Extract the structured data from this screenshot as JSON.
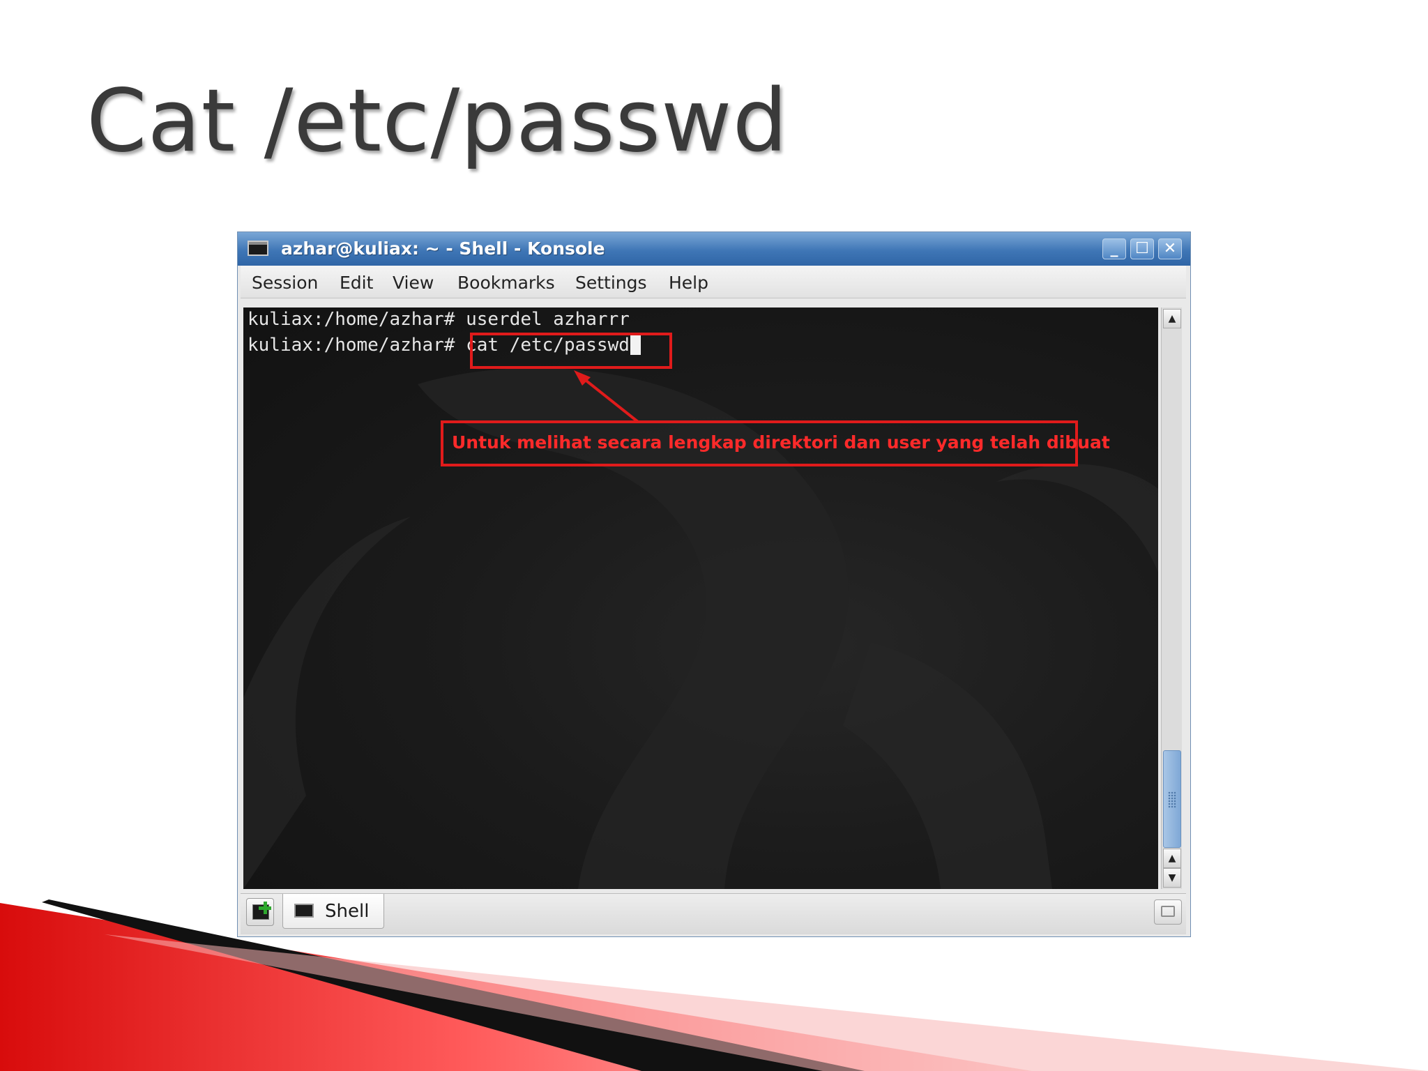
{
  "slide": {
    "title": "Cat /etc/passwd"
  },
  "window": {
    "title": "azhar@kuliax: ~ - Shell - Konsole",
    "controls": {
      "minimize_icon": "minimize-icon",
      "maximize_icon": "maximize-icon",
      "close_icon": "close-icon"
    }
  },
  "menu": {
    "items": [
      "Session",
      "Edit",
      "View",
      "Bookmarks",
      "Settings",
      "Help"
    ]
  },
  "terminal": {
    "lines": [
      {
        "prompt": "kuliax:/home/azhar#",
        "command": "userdel azharrr"
      },
      {
        "prompt": "kuliax:/home/azhar#",
        "command": "cat /etc/passwd"
      }
    ],
    "annotation": "Untuk melihat secara lengkap direktori dan user yang telah dibuat",
    "annotation_color": "#e01b1b",
    "background_color": "#1b1b1b",
    "text_color": "#e6e6e6"
  },
  "tabs": [
    {
      "label": "Shell",
      "icon": "terminal-icon",
      "active": true
    }
  ],
  "colors": {
    "titlebar": "#3f76b6",
    "decor_red": "#e01b1b"
  }
}
